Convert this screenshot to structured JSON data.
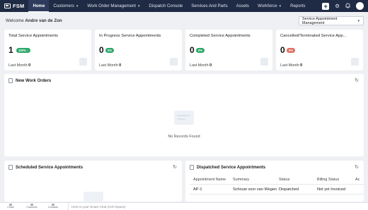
{
  "app": {
    "name": "FSM"
  },
  "nav": {
    "items": [
      {
        "label": "Home",
        "dropdown": false
      },
      {
        "label": "Customers",
        "dropdown": true
      },
      {
        "label": "Work Order Management",
        "dropdown": true
      },
      {
        "label": "Dispatch Console",
        "dropdown": false
      },
      {
        "label": "Services And Parts",
        "dropdown": false
      },
      {
        "label": "Assets",
        "dropdown": false
      },
      {
        "label": "Workforce",
        "dropdown": true
      },
      {
        "label": "Reports",
        "dropdown": false
      }
    ],
    "active": "Home",
    "plus_label": "+"
  },
  "welcome": {
    "prefix": "Welcome ",
    "name": "Andre van de Zon"
  },
  "view_select": {
    "value": "Service Appointment Management"
  },
  "stats": [
    {
      "title": "Total Service Appointments",
      "value": "1",
      "badge": "100%",
      "badge_icon": "↑",
      "badge_color": "green",
      "last_month_label": "Last Month",
      "last_month_value": "0"
    },
    {
      "title": "In Progress Service Appointments",
      "value": "0",
      "badge": "0%",
      "badge_icon": "",
      "badge_color": "green",
      "last_month_label": "Last Month",
      "last_month_value": "0"
    },
    {
      "title": "Completed Service Appointments",
      "value": "0",
      "badge": "0%",
      "badge_icon": "",
      "badge_color": "green",
      "last_month_label": "Last Month",
      "last_month_value": "0"
    },
    {
      "title": "Cancelled/Terminated Service App...",
      "value": "0",
      "badge": "0%",
      "badge_icon": "",
      "badge_color": "red",
      "last_month_label": "Last Month",
      "last_month_value": "0"
    }
  ],
  "new_work_orders": {
    "title": "New Work Orders",
    "empty_text": "No Records Found"
  },
  "scheduled": {
    "title": "Scheduled Service Appointments"
  },
  "dispatched": {
    "title": "Dispatched Service Appointments",
    "columns": [
      "Appointment Name",
      "Summary",
      "Status",
      "Billing Status",
      "Ac"
    ],
    "rows": [
      [
        "AP-1",
        "Schouw voor van Wegen",
        "Dispatched",
        "Not yet Invoiced",
        ""
      ]
    ]
  },
  "bottombar": {
    "buttons": [
      "Chats",
      "Channels",
      "Contacts"
    ],
    "zia_placeholder": "Here is your Smart Chat (Ctrl+Space)"
  },
  "colors": {
    "nav_bg": "#1f2a44",
    "badge_green": "#2ea86a",
    "badge_red": "#e06d62"
  }
}
